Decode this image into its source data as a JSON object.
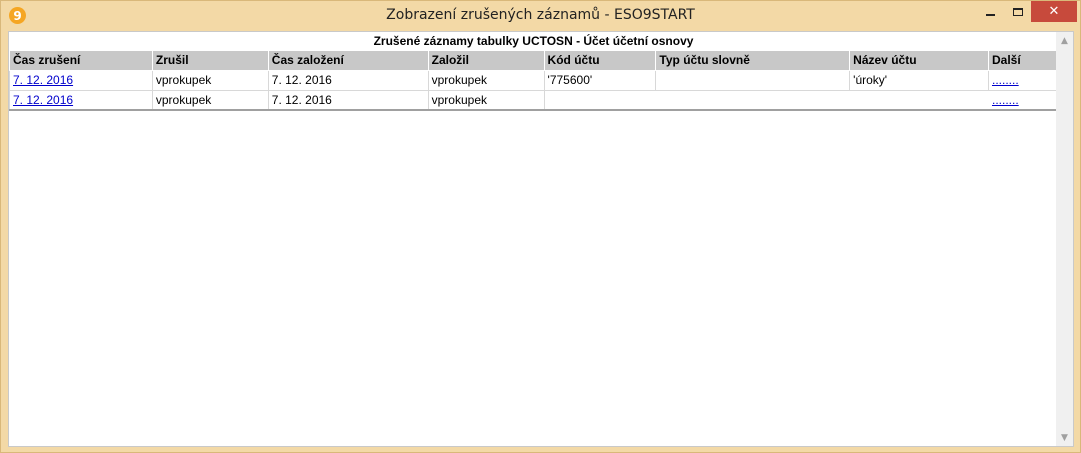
{
  "window": {
    "title": "Zobrazení zrušených záznamů - ESO9START",
    "app_icon_glyph": "9",
    "minimize_label": "",
    "close_label": "✕"
  },
  "table": {
    "caption": "Zrušené záznamy tabulky UCTOSN - Účet účetní osnovy",
    "columns": [
      "Čas zrušení",
      "Zrušil",
      "Čas založení",
      "Založil",
      "Kód účtu",
      "Typ účtu slovně",
      "Název účtu",
      "Další"
    ],
    "rows": [
      {
        "cas_zruseni": "7. 12. 2016",
        "zrusil": "vprokupek",
        "cas_zalozeni": "7. 12. 2016",
        "zalozil": "vprokupek",
        "kod_uctu": "'775600'",
        "typ_uctu_slovne": "",
        "nazev_uctu": "'úroky'",
        "dalsi": "........"
      },
      {
        "cas_zruseni": "7. 12. 2016",
        "zrusil": "vprokupek",
        "cas_zalozeni": "7. 12. 2016",
        "zalozil": "vprokupek",
        "kod_uctu": "",
        "typ_uctu_slovne": "",
        "nazev_uctu": "",
        "dalsi": "........"
      }
    ]
  },
  "scrollbar": {
    "up_arrow": "▲",
    "down_arrow": "▼"
  },
  "colors": {
    "frame": "#f3d9a6",
    "header_bg": "#c8c8c8",
    "link": "#0000cc",
    "close_button": "#c74a3c"
  }
}
